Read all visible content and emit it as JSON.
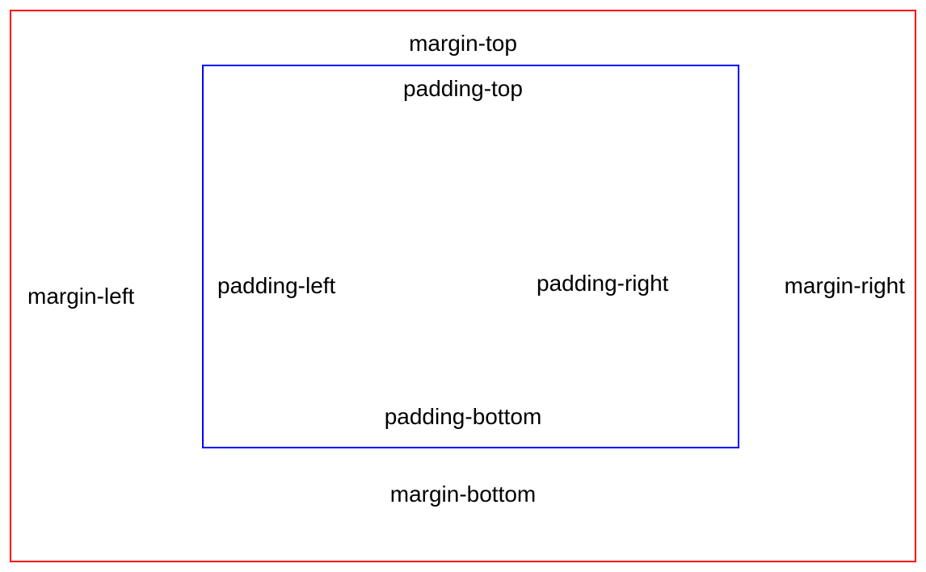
{
  "diagram": {
    "outer": {
      "color": "#ff0000",
      "labels": {
        "top": "margin-top",
        "bottom": "margin-bottom",
        "left": "margin-left",
        "right": "margin-right"
      }
    },
    "inner": {
      "color": "#0000ff",
      "labels": {
        "top": "padding-top",
        "bottom": "padding-bottom",
        "left": "padding-left",
        "right": "padding-right"
      }
    }
  }
}
